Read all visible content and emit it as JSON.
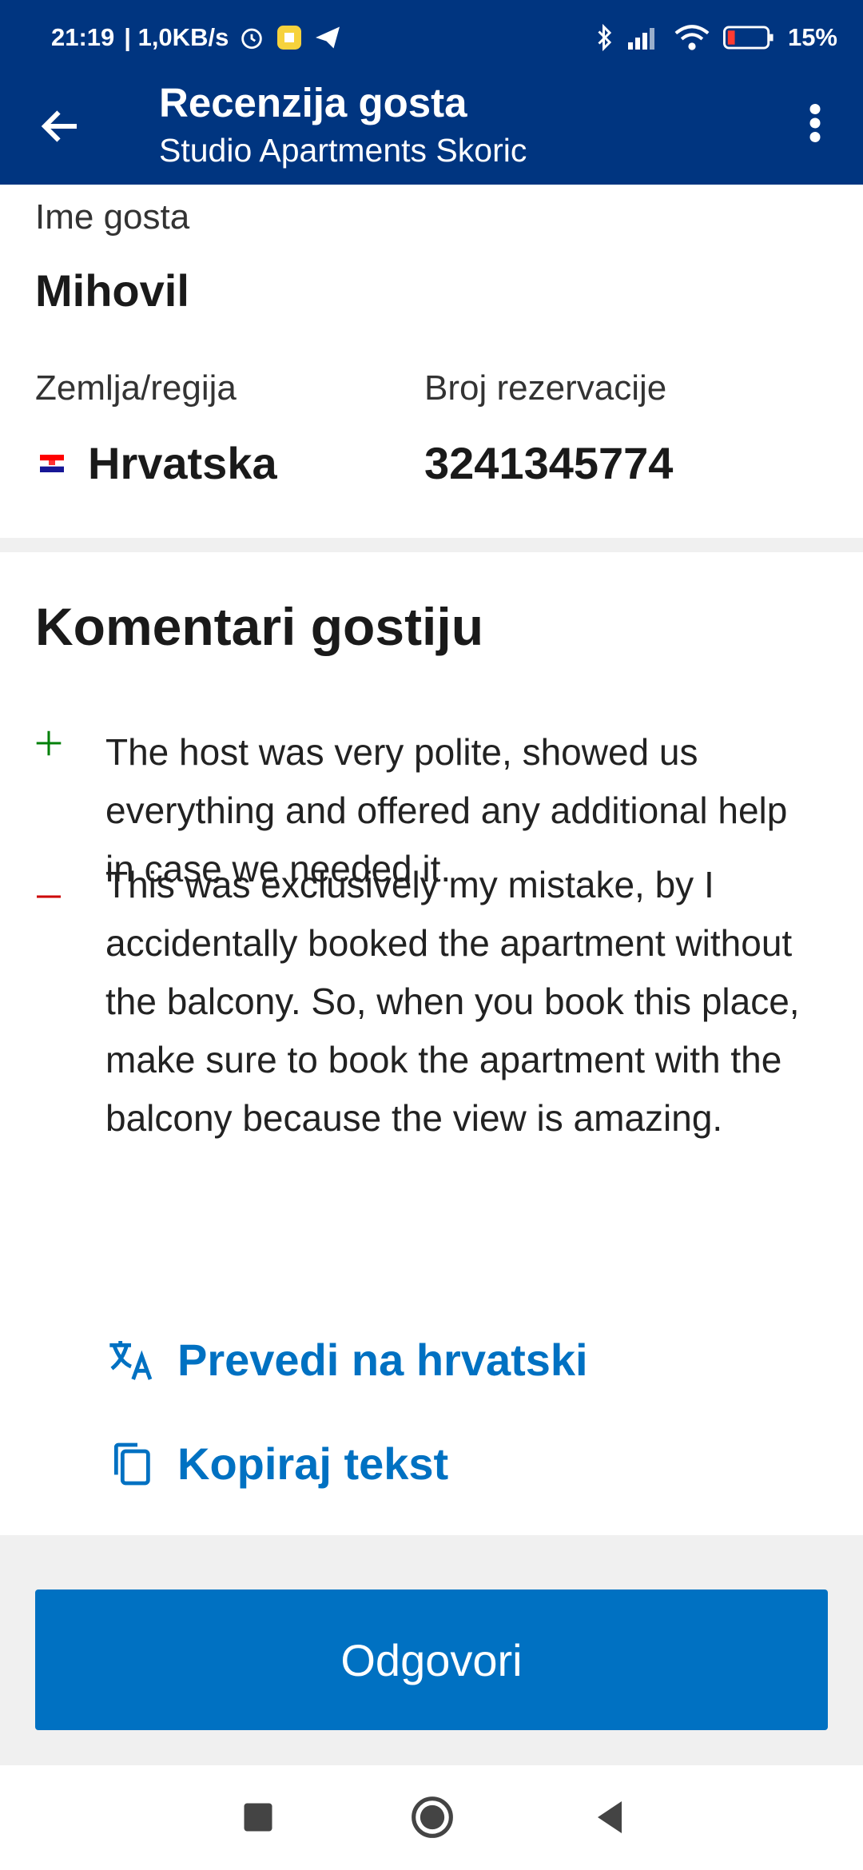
{
  "status_bar": {
    "time": "21:19",
    "speed": "| 1,0KB/s",
    "battery": "15%"
  },
  "toolbar": {
    "title": "Recenzija gosta",
    "subtitle": "Studio Apartments Skoric"
  },
  "guest": {
    "name_label": "Ime gosta",
    "name_value": "Mihovil",
    "country_label": "Zemlja/regija",
    "country_value": "Hrvatska",
    "booking_label": "Broj rezervacije",
    "booking_value": "3241345774"
  },
  "comments": {
    "title": "Komentari gostiju",
    "positive": "The host was very polite, showed us everything and offered any additional help in case we needed it.",
    "negative": "This was exclusively my mistake, by I accidentally booked the apartment without the balcony. So, when you book this place, make sure to book the apartment with the balcony because the view is amazing.",
    "translate_label": "Prevedi na hrvatski",
    "copy_label": "Kopiraj tekst"
  },
  "actions": {
    "reply_label": "Odgovori"
  },
  "icons": {
    "back": "arrow-left-icon",
    "overflow": "more-vert-icon",
    "translate": "translate-icon",
    "copy": "copy-icon",
    "flag": "croatia-flag-icon"
  },
  "colors": {
    "app_bar": "#003580",
    "accent": "#0071c2",
    "positive": "#008009",
    "negative": "#cc0000"
  }
}
